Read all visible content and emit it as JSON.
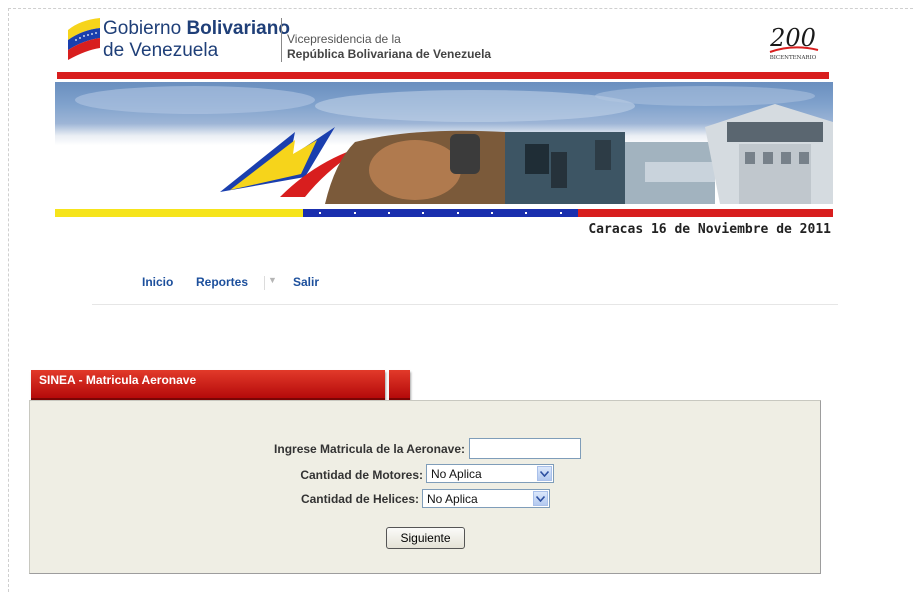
{
  "header": {
    "gov_line1_regular": "Gobierno",
    "gov_line1_bold": "Bolivariano",
    "gov_line2": "de Venezuela",
    "vp_line1": "Vicepresidencia de la",
    "vp_line2": "República Bolivariana de Venezuela",
    "bicentenario_number": "200",
    "bicentenario_label": "BICENTENARIO"
  },
  "date_text": "Caracas 16 de Noviembre de 2011",
  "nav": {
    "items": [
      "Inicio",
      "Reportes",
      "Salir"
    ],
    "reportes_arrow": "▼"
  },
  "panel": {
    "title": "SINEA - Matricula Aeronave"
  },
  "form": {
    "matricula_label": "Ingrese Matricula de la Aeronave:",
    "matricula_value": "",
    "motores_label": "Cantidad de Motores:",
    "motores_selected": "No Aplica",
    "helices_label": "Cantidad de Helices:",
    "helices_selected": "No Aplica",
    "submit_label": "Siguiente"
  },
  "colors": {
    "accent_red": "#d81e1e",
    "nav_blue": "#1c4f9c",
    "flag_yellow": "#f6e41b",
    "flag_blue": "#1a2fae",
    "panel_bg": "#efeee4"
  }
}
